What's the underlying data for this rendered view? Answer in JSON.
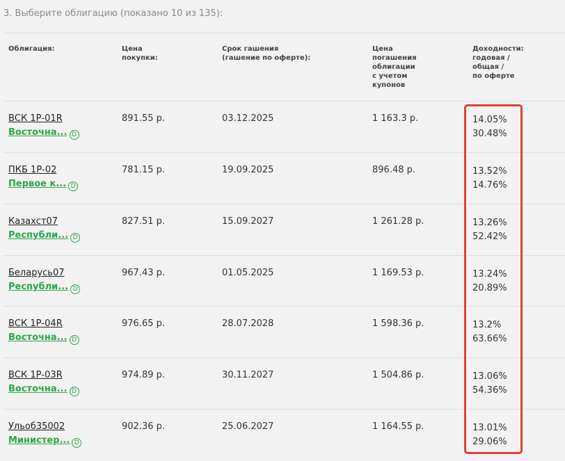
{
  "step": {
    "title": "3. Выберите облигацию (показано 10 из 135):"
  },
  "headers": {
    "bond": [
      "Облигация:"
    ],
    "buy_price": [
      "Цена",
      "покупки:"
    ],
    "maturity": [
      "Срок гашения",
      "(гашение по оферте):"
    ],
    "redemption": [
      "Цена",
      "погашения",
      "облигации",
      "с учетом",
      "купонов"
    ],
    "yields": [
      "Доходности:",
      "годовая /",
      "общая /",
      "по оферте"
    ]
  },
  "rows": [
    {
      "name": "ВСК 1Р-01R",
      "issuer": "Восточна...",
      "price": "891.55 р.",
      "maturity": "03.12.2025",
      "redemption": "1 163.3 р.",
      "yield_annual": "14.05%",
      "yield_total": "30.48%"
    },
    {
      "name": "ПКБ 1Р-02",
      "issuer": "Первое к...",
      "price": "781.15 р.",
      "maturity": "19.09.2025",
      "redemption": "896.48 р.",
      "yield_annual": "13.52%",
      "yield_total": "14.76%"
    },
    {
      "name": "Казахст07",
      "issuer": "Республи...",
      "price": "827.51 р.",
      "maturity": "15.09.2027",
      "redemption": "1 261.28 р.",
      "yield_annual": "13.26%",
      "yield_total": "52.42%"
    },
    {
      "name": "Беларусь07",
      "issuer": "Республи...",
      "price": "967.43 р.",
      "maturity": "01.05.2025",
      "redemption": "1 169.53 р.",
      "yield_annual": "13.24%",
      "yield_total": "20.89%"
    },
    {
      "name": "ВСК 1Р-04R",
      "issuer": "Восточна...",
      "price": "976.65 р.",
      "maturity": "28.07.2028",
      "redemption": "1 598.36 р.",
      "yield_annual": "13.2%",
      "yield_total": "63.66%"
    },
    {
      "name": "ВСК 1Р-03R",
      "issuer": "Восточна...",
      "price": "974.89 р.",
      "maturity": "30.11.2027",
      "redemption": "1 504.86 р.",
      "yield_annual": "13.06%",
      "yield_total": "54.36%"
    },
    {
      "name": "Ульоб35002",
      "issuer": "Министер...",
      "price": "902.36 р.",
      "maturity": "25.06.2027",
      "redemption": "1 164.55 р.",
      "yield_annual": "13.01%",
      "yield_total": "29.06%"
    }
  ],
  "icons": {
    "dividend_glyph": "D",
    "dividend_icon": "d-circle-icon"
  },
  "colors": {
    "issuer_link": "#2aa84a",
    "highlight": "#e0403a",
    "background": "#f2f2f2"
  }
}
